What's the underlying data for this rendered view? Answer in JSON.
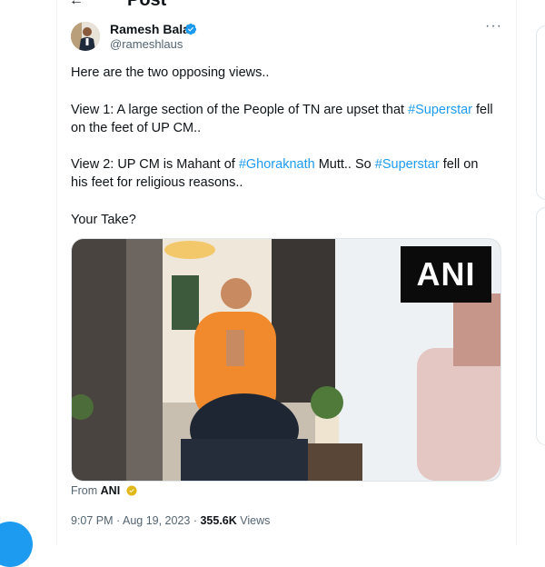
{
  "header": {
    "back_arrow": "←",
    "title": "Post"
  },
  "author": {
    "name": "Ramesh Bala",
    "handle": "@rameshlaus",
    "verified": true
  },
  "more_menu": "···",
  "tweet": {
    "line1": "Here are the two opposing views..",
    "view1_a": "View 1: A large section of the People of TN are upset that ",
    "view1_tag": "#Superstar",
    "view1_b": " fell",
    "view1_c": "on the feet of UP CM..",
    "view2_a": "View 2: UP CM is Mahant of ",
    "view2_tag1": "#Ghoraknath",
    "view2_b": " Mutt.. So ",
    "view2_tag2": "#Superstar",
    "view2_c": " fell on",
    "view2_d": "his feet for religious reasons..",
    "closing": "Your Take?"
  },
  "media": {
    "watermark": "ANI"
  },
  "source": {
    "prefix": "From",
    "name": "ANI"
  },
  "meta": {
    "time": "9:07 PM",
    "sep1": " · ",
    "date": "Aug 19, 2023",
    "sep2": " · ",
    "views_count": "355.6K",
    "views_label": " Views"
  },
  "colors": {
    "accent": "#1d9bf0",
    "text": "#0f1419",
    "muted": "#536471",
    "gold": "#e2b719"
  }
}
